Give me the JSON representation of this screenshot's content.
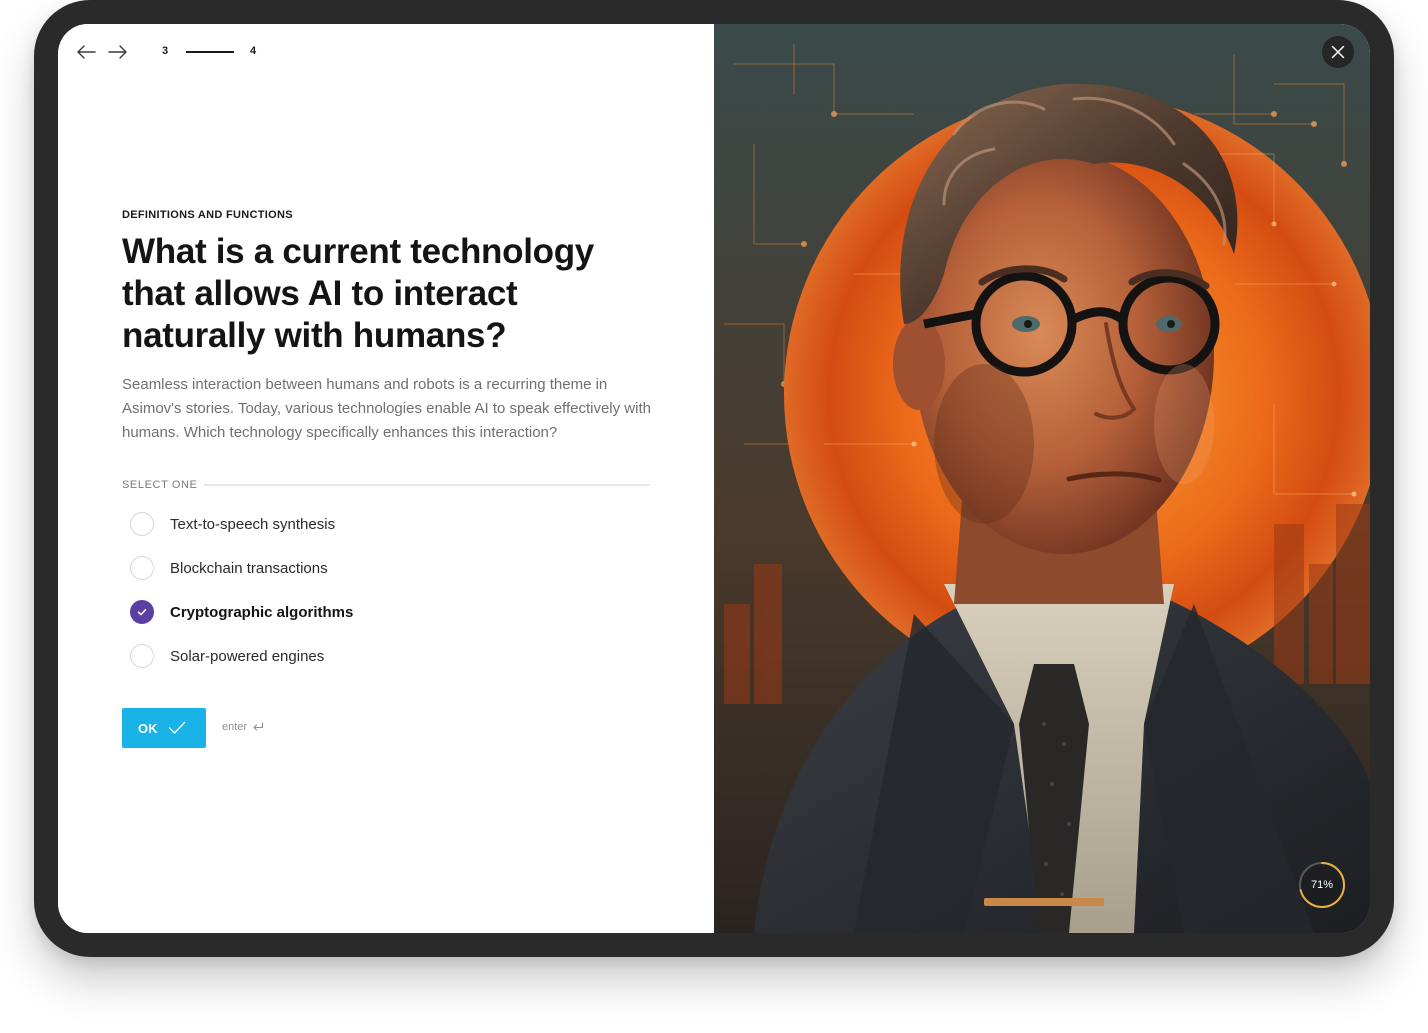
{
  "nav": {
    "back_icon": "arrow-left-icon",
    "forward_icon": "arrow-right-icon",
    "current_step": "3",
    "next_step": "4"
  },
  "question": {
    "category": "DEFINITIONS AND FUNCTIONS",
    "title": "What is a current technology that allows AI to interact naturally with humans?",
    "description": "Seamless interaction between humans and robots is a recurring theme in Asimov's stories. Today, various technologies enable AI to speak effectively with humans. Which technology specifically enhances this interaction?"
  },
  "options": {
    "label": "SELECT ONE",
    "items": [
      {
        "label": "Text-to-speech synthesis",
        "selected": false
      },
      {
        "label": "Blockchain transactions",
        "selected": false
      },
      {
        "label": "Cryptographic algorithms",
        "selected": true
      },
      {
        "label": "Solar-powered engines",
        "selected": false
      }
    ]
  },
  "submit": {
    "ok_label": "OK",
    "ok_icon": "check-icon",
    "enter_hint": "enter",
    "enter_icon": "enter-return-icon"
  },
  "image_panel": {
    "close_icon": "close-icon",
    "progress_text": "71%",
    "progress_value": 0.71
  },
  "colors": {
    "accent_purple": "#5b3fa4",
    "ok_blue": "#19b3e8",
    "progress_ring": "#e8b23a"
  }
}
